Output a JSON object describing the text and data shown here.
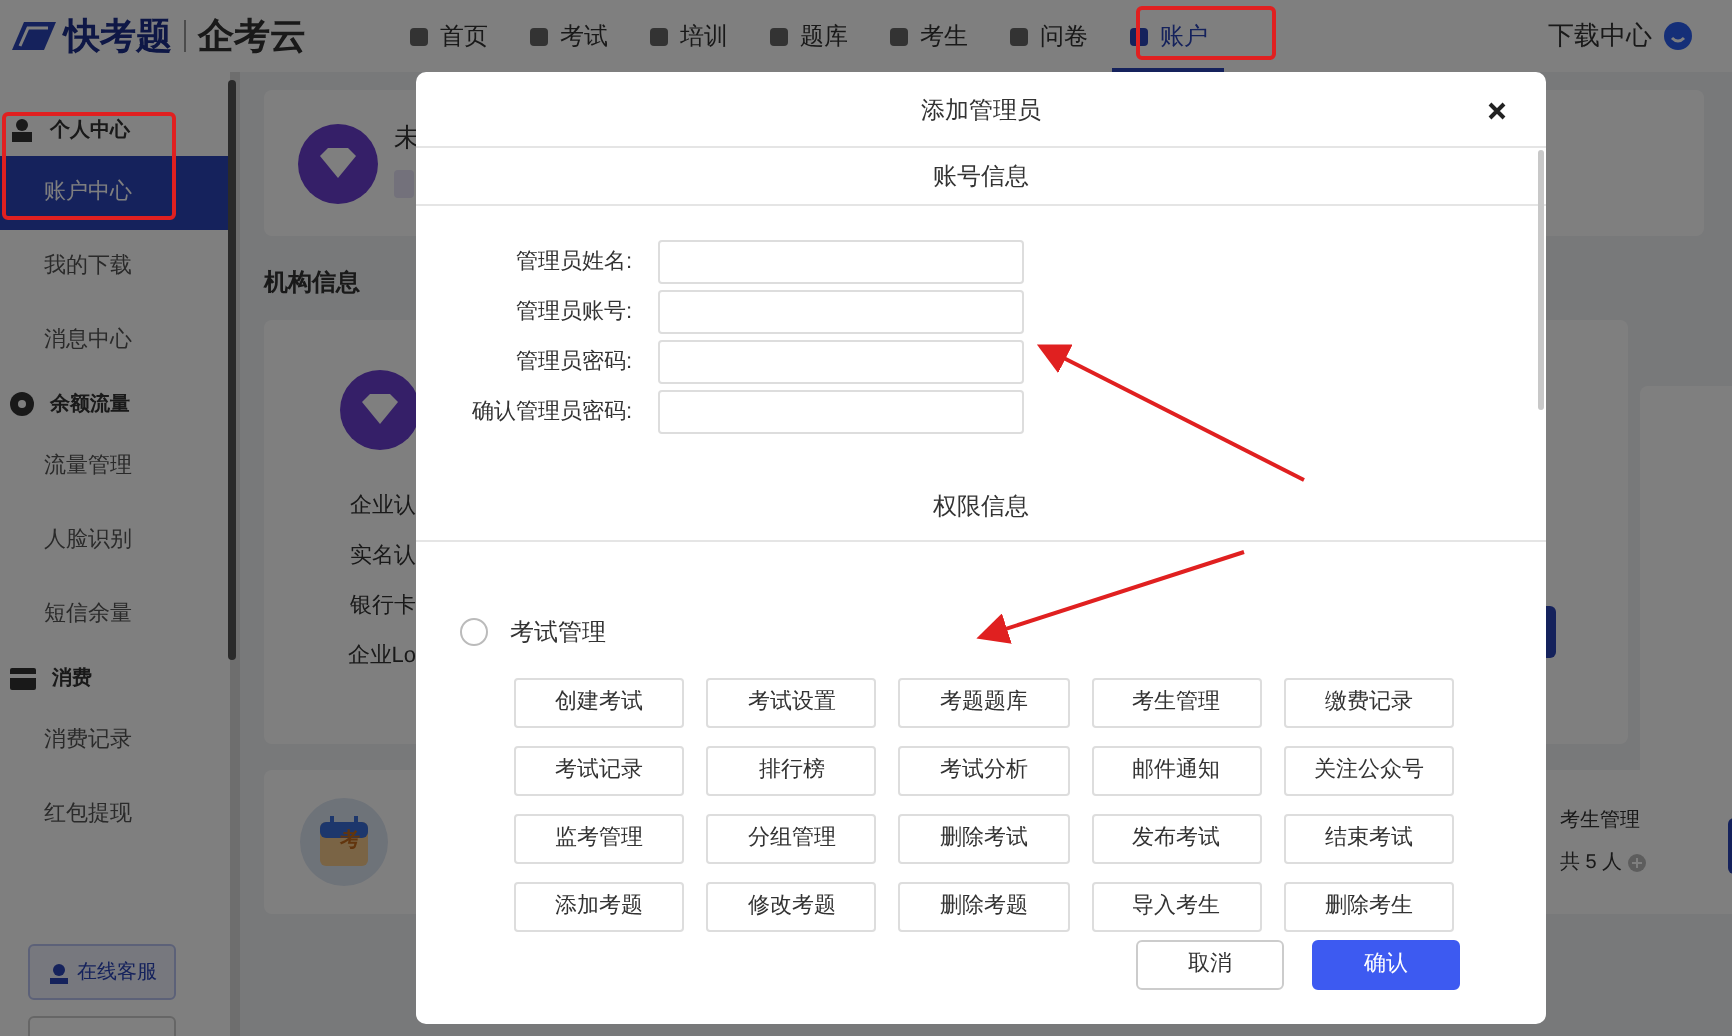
{
  "header": {
    "logo": "快考题",
    "brand": "企考云",
    "download": "下载中心",
    "nav": [
      {
        "label": "首页",
        "selected": false
      },
      {
        "label": "考试",
        "selected": false
      },
      {
        "label": "培训",
        "selected": false
      },
      {
        "label": "题库",
        "selected": false
      },
      {
        "label": "考生",
        "selected": false
      },
      {
        "label": "问卷",
        "selected": false
      },
      {
        "label": "账户",
        "selected": true
      }
    ]
  },
  "sidebar": {
    "groups": [
      {
        "title": "个人中心",
        "kind": "person",
        "items": [
          {
            "label": "账户中心",
            "selected": true
          },
          {
            "label": "我的下载",
            "selected": false
          },
          {
            "label": "消息中心",
            "selected": false
          }
        ]
      },
      {
        "title": "余额流量",
        "kind": "coin",
        "items": [
          {
            "label": "流量管理",
            "selected": false
          },
          {
            "label": "人脸识别",
            "selected": false
          },
          {
            "label": "短信余量",
            "selected": false
          }
        ]
      },
      {
        "title": "消费",
        "kind": "card",
        "items": [
          {
            "label": "消费记录",
            "selected": false
          },
          {
            "label": "红包提现",
            "selected": false
          }
        ]
      }
    ],
    "support_button": "在线客服"
  },
  "background": {
    "profile_name": "未",
    "section_title": "机构信息",
    "info_labels": [
      "企业认",
      "实名认",
      "银行卡",
      "企业Lo"
    ],
    "stat_title": "考生管理",
    "stat_count": "共 5 人",
    "calendar_char": "考"
  },
  "dialog": {
    "title": "添加管理员",
    "account_section": "账号信息",
    "fields": [
      {
        "label": "管理员姓名:"
      },
      {
        "label": "管理员账号:"
      },
      {
        "label": "管理员密码:"
      },
      {
        "label": "确认管理员密码:"
      }
    ],
    "permission_section": "权限信息",
    "permission_group": {
      "label": "考试管理",
      "checked": false
    },
    "permissions": [
      "创建考试",
      "考试设置",
      "考题题库",
      "考生管理",
      "缴费记录",
      "考试记录",
      "排行榜",
      "考试分析",
      "邮件通知",
      "关注公众号",
      "监考管理",
      "分组管理",
      "删除考试",
      "发布考试",
      "结束考试",
      "添加考题",
      "修改考题",
      "删除考题",
      "导入考生",
      "删除考生"
    ],
    "buttons": [
      {
        "label": "取消",
        "kind": "secondary"
      },
      {
        "label": "确认",
        "kind": "primary"
      }
    ]
  }
}
